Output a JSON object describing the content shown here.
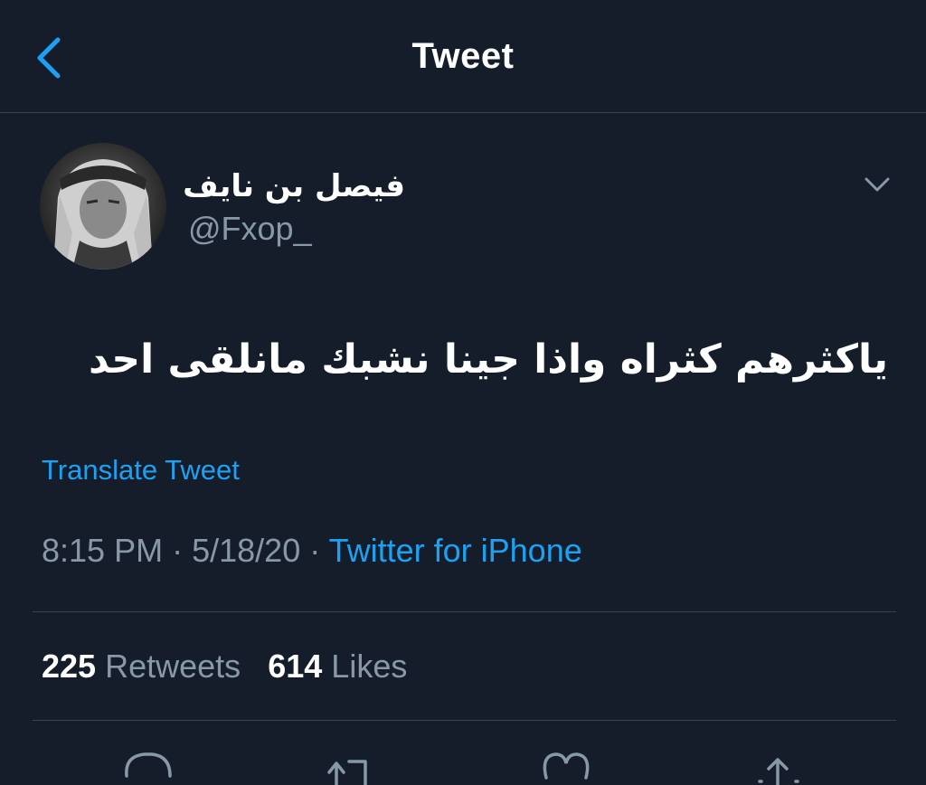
{
  "header": {
    "title": "Tweet",
    "back_icon": "chevron-left-icon"
  },
  "author": {
    "display_name": "فيصل بن نايف",
    "handle": "@Fxop_"
  },
  "tweet": {
    "text": "ياكثرهم كثراه واذا جينا نشبك مانلقى احد",
    "translate_label": "Translate Tweet",
    "time": "8:15 PM",
    "date": "5/18/20",
    "separator": "·",
    "source": "Twitter for iPhone"
  },
  "stats": {
    "retweets_count": "225",
    "retweets_label": "Retweets",
    "likes_count": "614",
    "likes_label": "Likes"
  },
  "actions": [
    "reply-icon",
    "retweet-icon",
    "like-icon",
    "share-icon"
  ],
  "colors": {
    "background": "#151d2b",
    "accent": "#1da1f2",
    "secondary_text": "#8899a6",
    "divider": "#38444d"
  }
}
